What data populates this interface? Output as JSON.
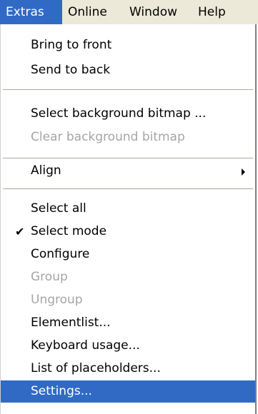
{
  "menubar": {
    "items": [
      {
        "label": "Extras",
        "active": true
      },
      {
        "label": "Online"
      },
      {
        "label": "Window"
      },
      {
        "label": "Help"
      }
    ]
  },
  "menu": {
    "bring_to_front": "Bring to front",
    "send_to_back": "Send to back",
    "select_background_bitmap": "Select background bitmap ...",
    "clear_background_bitmap": "Clear background bitmap",
    "align": "Align",
    "select_all": "Select all",
    "select_mode": "Select mode",
    "configure": "Configure",
    "group": "Group",
    "ungroup": "Ungroup",
    "elementlist": "Elementlist...",
    "keyboard_usage": "Keyboard usage...",
    "list_of_placeholders": "List of placeholders...",
    "settings": "Settings..."
  },
  "icons": {
    "check": "✔",
    "submenu_arrow": "submenu-arrow-icon"
  },
  "colors": {
    "menubar_bg": "#ece9d8",
    "highlight": "#316ac5",
    "disabled_text": "#a5a5a5"
  }
}
